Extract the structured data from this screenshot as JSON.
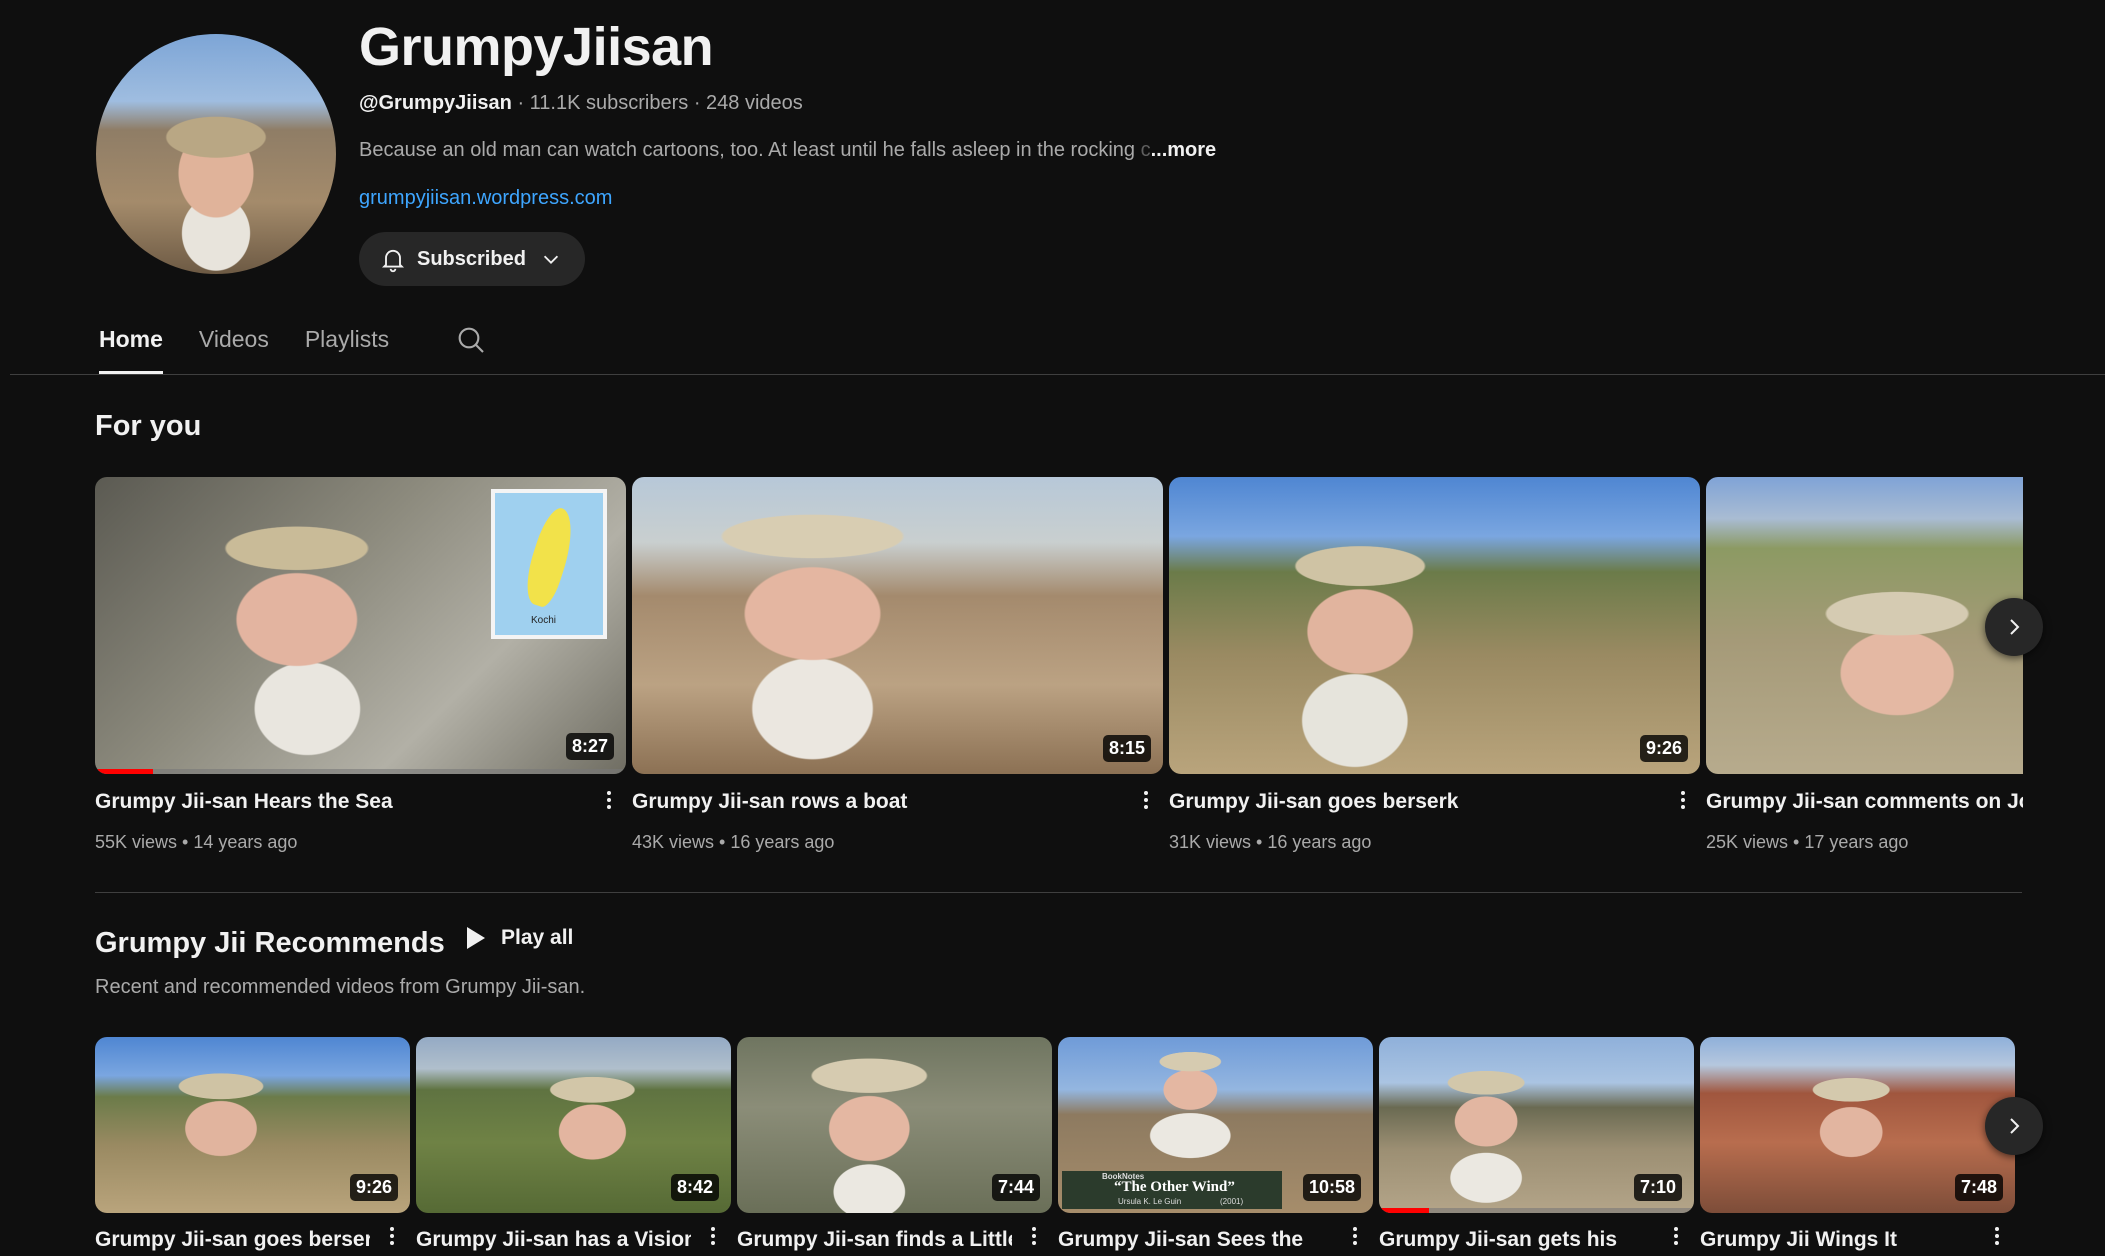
{
  "channel": {
    "name": "GrumpyJiisan",
    "handle": "@GrumpyJiisan",
    "meta_rest": " · 11.1K subscribers · 248 videos",
    "description": "Because an old man can watch cartoons, too. At least until he falls asleep in the rocking",
    "description_fade": " c",
    "more_label": "...more",
    "link": "grumpyjiisan.wordpress.com",
    "subscribe_label": "Subscribed"
  },
  "tabs": [
    {
      "label": "Home",
      "active": true
    },
    {
      "label": "Videos",
      "active": false
    },
    {
      "label": "Playlists",
      "active": false
    }
  ],
  "for_you": {
    "title": "For you",
    "videos": [
      {
        "title": "Grumpy Jii-san Hears the Sea",
        "stats": "55K views • 14 years ago",
        "duration": "8:27",
        "progress": 0.11
      },
      {
        "title": "Grumpy Jii-san rows a boat",
        "stats": "43K views • 16 years ago",
        "duration": "8:15"
      },
      {
        "title": "Grumpy Jii-san goes berserk",
        "stats": "31K views • 16 years ago",
        "duration": "9:26"
      },
      {
        "title": "Grumpy Jii-san comments on Jo",
        "stats": "25K views • 17 years ago",
        "duration": ""
      }
    ]
  },
  "recommends": {
    "title": "Grumpy Jii Recommends",
    "play_all": "Play all",
    "description": "Recent and recommended videos from Grumpy Jii-san.",
    "videos": [
      {
        "title": "Grumpy Jii-san goes berserk",
        "duration": "9:26"
      },
      {
        "title": "Grumpy Jii-san has a Vision",
        "duration": "8:42"
      },
      {
        "title": "Grumpy Jii-san finds a Little",
        "duration": "7:44"
      },
      {
        "title": "Grumpy Jii-san Sees the",
        "duration": "10:58",
        "overlay_top": "BookNotes",
        "overlay_main": "“The Other Wind”",
        "overlay_sub": "Ursula K. Le Guin",
        "overlay_year": "(2001)"
      },
      {
        "title": "Grumpy Jii-san gets his",
        "duration": "7:10",
        "progress": 0.16
      },
      {
        "title": "Grumpy Jii Wings It",
        "duration": "7:48"
      }
    ]
  },
  "map_label": "Kochi",
  "colors": {
    "background": "#0f0f0f",
    "link": "#3ea6ff",
    "progress": "#ff0000",
    "chip": "#272727"
  }
}
